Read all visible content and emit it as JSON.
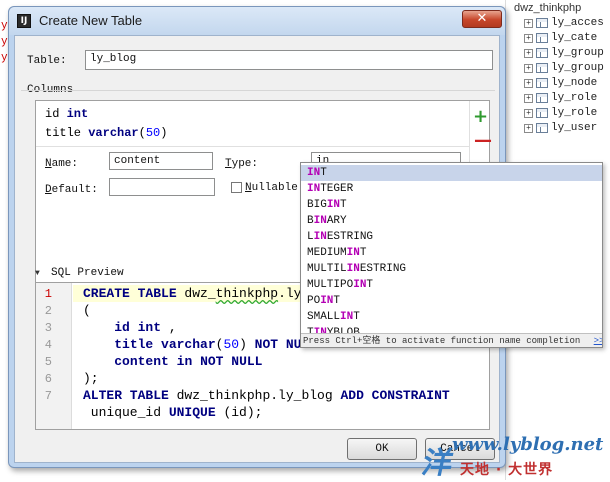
{
  "background": {
    "editor_fragments": [
      "y",
      "y",
      "y"
    ],
    "tree_header": "dwz_thinkphp",
    "tree_items": [
      "ly_acces",
      "ly_cate",
      "ly_group",
      "ly_group",
      "ly_node",
      "ly_role",
      "ly_role",
      "ly_user"
    ]
  },
  "dialog": {
    "title": "Create New Table",
    "close_glyph": "✕",
    "table_label": "Table:",
    "table_value": "ly_blog",
    "columns_label": "Columns",
    "columns": [
      {
        "name": "id",
        "type": "int",
        "size": ""
      },
      {
        "name": "title",
        "type": "varchar",
        "size": "50"
      }
    ],
    "add_glyph": "+",
    "remove_glyph": "—",
    "name_label": "Name:",
    "name_value": "content",
    "type_label": "Type:",
    "type_value": "in",
    "default_label": "Default:",
    "default_value": "",
    "nullable_label": "Nullable",
    "nullable_checked": false,
    "sql_preview_label": "SQL Preview",
    "ok_label": "OK",
    "cancel_label": "Cancel"
  },
  "sql": {
    "line_numbers": [
      "1",
      "2",
      "3",
      "4",
      "5",
      "6",
      "7"
    ],
    "current_line": 1
  },
  "autocomplete": {
    "typed": "in",
    "items": [
      "INT",
      "INTEGER",
      "BIGINT",
      "BINARY",
      "LINESTRING",
      "MEDIUMINT",
      "MULTILINESTRING",
      "MULTIPOINT",
      "POINT",
      "SMALLINT",
      "TINYBLOB"
    ],
    "selected_index": 0,
    "hint": "Press Ctrl+空格 to activate function name completion",
    "hint_link": ">>"
  },
  "watermark": {
    "url": "www.lyblog.net",
    "subtitle": "天地 · 大世界"
  }
}
